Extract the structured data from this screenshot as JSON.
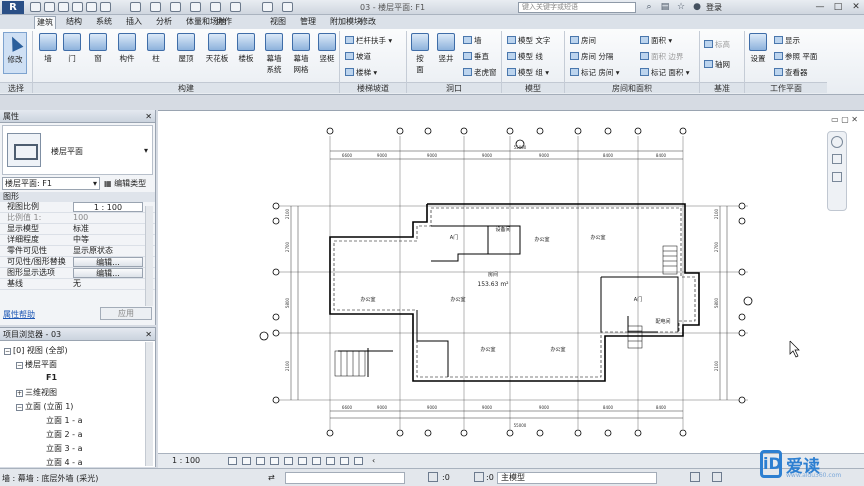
{
  "titlebar": {
    "document_title": "03 - 楼层平面: F1",
    "search_placeholder": "键入关键字或短语",
    "login_label": "登录"
  },
  "ribbon_tabs": [
    "建筑",
    "结构",
    "系统",
    "插入",
    "分析",
    "体量和场地",
    "协作",
    "视图",
    "管理",
    "附加模块",
    "修改"
  ],
  "ribbon": {
    "modify": "修改",
    "select": "选择",
    "build": {
      "label": "构建",
      "wall": "墙",
      "door": "门",
      "window": "窗",
      "component": "构件",
      "column": "柱",
      "roof": "屋顶",
      "ceiling": "天花板",
      "floor": "楼板",
      "curtain_system": "幕墙\n系统",
      "curtain_grid": "幕墙\n网格",
      "mullion": "竖梃"
    },
    "circulation": {
      "label": "楼梯坡道",
      "railing": "栏杆扶手",
      "ramp": "坡道",
      "stair": "楼梯"
    },
    "opening": {
      "label": "洞口",
      "by_face": "按\n面",
      "shaft": "竖井",
      "wall": "墙",
      "vertical": "垂直",
      "dormer": "老虎窗"
    },
    "model": {
      "label": "模型",
      "model_text": "模型 文字",
      "model_line": "模型 线",
      "model_group": "模型 组"
    },
    "room_area": {
      "label": "房间和面积",
      "room": "房间",
      "room_separator": "房间 分隔",
      "tag_room": "标记 房间",
      "area": "面积",
      "area_boundary": "面积 边界",
      "tag_area": "标记 面积"
    },
    "datum": {
      "label": "基准",
      "level": "标高",
      "grid": "轴网"
    },
    "work_plane": {
      "label": "工作平面",
      "set": "设置",
      "show": "显示",
      "ref_plane": "参照 平面",
      "viewer": "查看器"
    }
  },
  "properties": {
    "title": "属性",
    "type_name": "楼层平面",
    "instance": "楼层平面: F1",
    "edit_type": "编辑类型",
    "section": "图形",
    "rows": [
      {
        "key": "视图比例",
        "value": "1 : 100"
      },
      {
        "key": "比例值 1:",
        "value": "100"
      },
      {
        "key": "显示模型",
        "value": "标准"
      },
      {
        "key": "详细程度",
        "value": "中等"
      },
      {
        "key": "零件可见性",
        "value": "显示原状态"
      },
      {
        "key": "可见性/图形替换",
        "value": "编辑..."
      },
      {
        "key": "图形显示选项",
        "value": "编辑..."
      },
      {
        "key": "基线",
        "value": "无"
      }
    ],
    "help": "属性帮助",
    "apply": "应用"
  },
  "browser": {
    "title": "项目浏览器 - 03",
    "items": [
      {
        "label": "[0] 视图 (全部)",
        "indent": 0
      },
      {
        "label": "楼层平面",
        "indent": 1
      },
      {
        "label": "F1",
        "indent": 2
      },
      {
        "label": "三维视图",
        "indent": 1
      },
      {
        "label": "立面 (立面 1)",
        "indent": 1
      },
      {
        "label": "立面 1 - a",
        "indent": 2
      },
      {
        "label": "立面 2 - a",
        "indent": 2
      },
      {
        "label": "立面 3 - a",
        "indent": 2
      },
      {
        "label": "立面 4 - a",
        "indent": 2
      }
    ]
  },
  "drawing": {
    "room_area_label": "房间",
    "room_area_value": "153.63 m²",
    "dim_total": "55000",
    "top_dims": [
      "6600",
      "9000",
      "9000",
      "9000",
      "9000",
      "8400",
      "8400"
    ],
    "bottom_dims": [
      "6600",
      "9000",
      "9000",
      "9000",
      "9000",
      "8400",
      "8400"
    ],
    "left_dims": [
      "2100",
      "2700",
      "5800",
      "2100"
    ],
    "right_dims": [
      "2100",
      "2700",
      "5800",
      "2100"
    ],
    "rooms": [
      "A门",
      "设备间",
      "办公室",
      "办公室",
      "办公室",
      "A门",
      "配电间",
      "办公室",
      "办公室",
      "办公室"
    ]
  },
  "viewbar": {
    "scale": "1 : 100"
  },
  "statusbar": {
    "text": "墙 : 幕墙 : 底层外墙 (采光)",
    "zero1": ":0",
    "zero2": ":0",
    "model": "主模型"
  },
  "watermark": {
    "logo": "iD",
    "text": "爱读",
    "url": "www.aidu360.com"
  }
}
